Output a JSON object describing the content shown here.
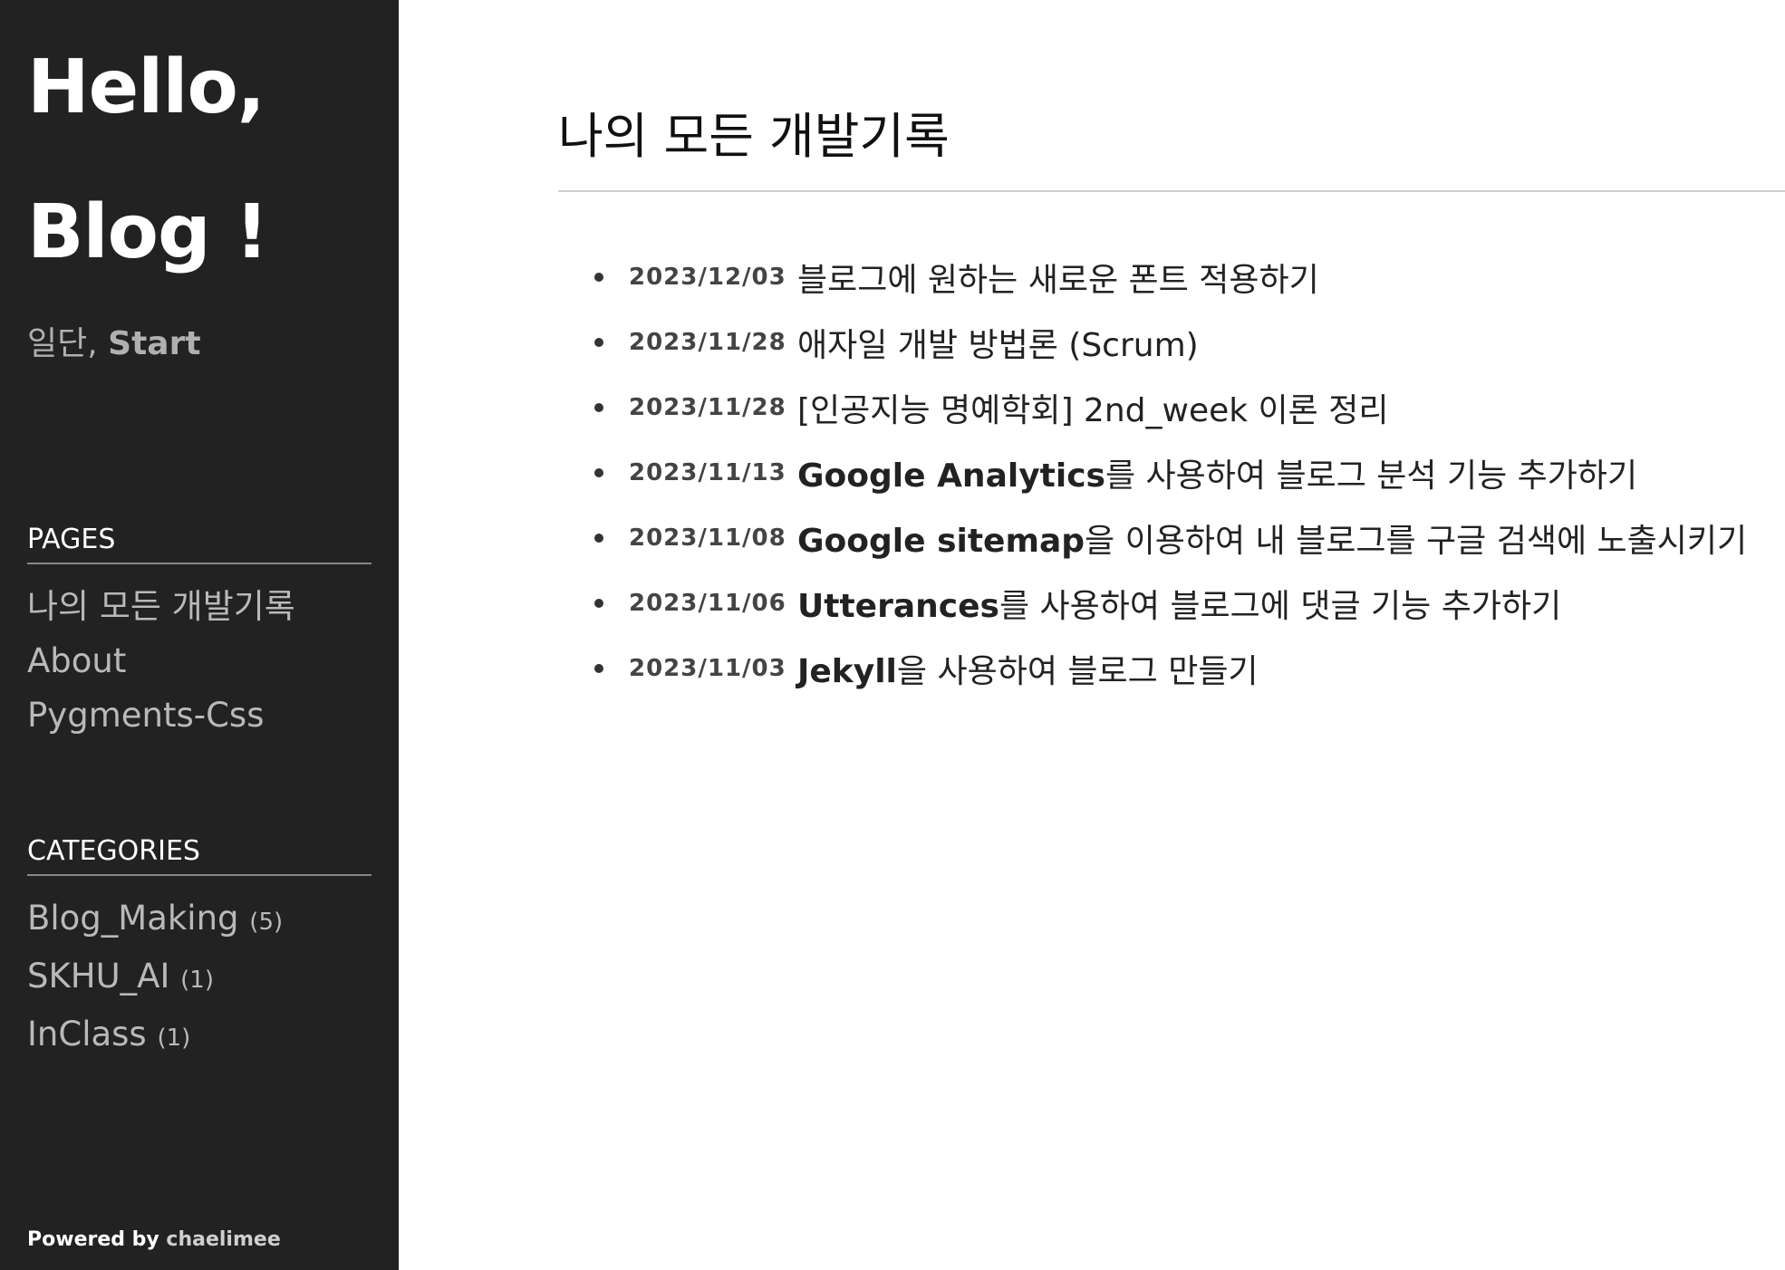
{
  "sidebar": {
    "title_line1": "Hello,",
    "title_line2": "Blog !",
    "tagline_plain": "일단, ",
    "tagline_strong": "Start",
    "pages_heading": "PAGES",
    "pages": [
      {
        "label": "나의 모든 개발기록"
      },
      {
        "label": "About"
      },
      {
        "label": "Pygments-Css"
      }
    ],
    "categories_heading": "CATEGORIES",
    "categories": [
      {
        "label": "Blog_Making",
        "count": "(5)"
      },
      {
        "label": "SKHU_AI",
        "count": "(1)"
      },
      {
        "label": "InClass",
        "count": "(1)"
      }
    ],
    "powered_label": "Powered by ",
    "powered_author": "chaelimee"
  },
  "main": {
    "title": "나의 모든 개발기록",
    "posts": [
      {
        "date": "2023/12/03",
        "title_strong": "",
        "title_rest": "블로그에 원하는 새로운 폰트 적용하기"
      },
      {
        "date": "2023/11/28",
        "title_strong": "",
        "title_rest": "애자일 개발 방법론 (Scrum)"
      },
      {
        "date": "2023/11/28",
        "title_strong": "",
        "title_rest": "[인공지능 명예학회] 2nd_week 이론 정리"
      },
      {
        "date": "2023/11/13",
        "title_strong": "Google Analytics",
        "title_rest": "를 사용하여 블로그 분석 기능 추가하기"
      },
      {
        "date": "2023/11/08",
        "title_strong": "Google sitemap",
        "title_rest": "을 이용하여 내 블로그를 구글 검색에 노출시키기"
      },
      {
        "date": "2023/11/06",
        "title_strong": "Utterances",
        "title_rest": "를 사용하여 블로그에 댓글 기능 추가하기"
      },
      {
        "date": "2023/11/03",
        "title_strong": "Jekyll",
        "title_rest": "을 사용하여 블로그 만들기"
      }
    ]
  }
}
